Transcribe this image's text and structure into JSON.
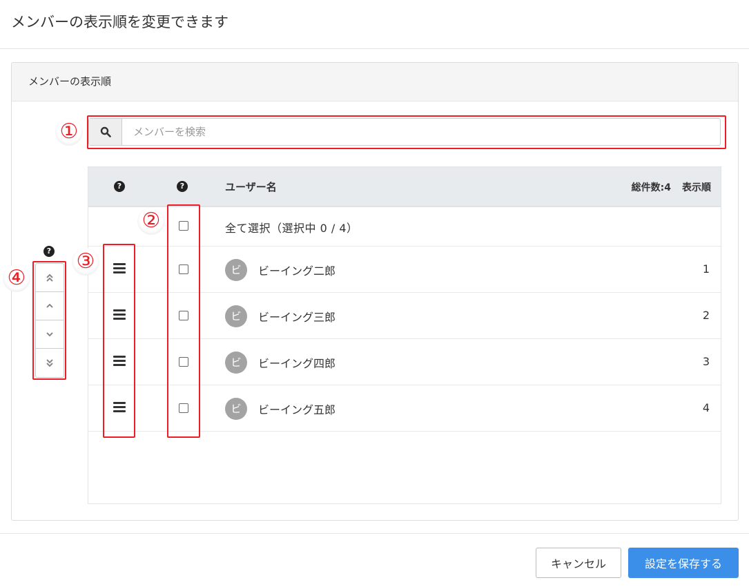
{
  "header": {
    "title": "メンバーの表示順を変更できます"
  },
  "panel": {
    "title": "メンバーの表示順"
  },
  "search": {
    "placeholder": "メンバーを検索",
    "icon": "search-icon"
  },
  "grid": {
    "columns": {
      "handle_help": "?",
      "select_help": "?",
      "user": "ユーザー名",
      "total": "総件数:4",
      "order": "表示順"
    },
    "select_all": "全て選択（選択中 0 / 4）",
    "members": [
      {
        "avatar": "ビ",
        "name": "ビーイング二郎",
        "order": "1"
      },
      {
        "avatar": "ビ",
        "name": "ビーイング三郎",
        "order": "2"
      },
      {
        "avatar": "ビ",
        "name": "ビーイング四郎",
        "order": "3"
      },
      {
        "avatar": "ビ",
        "name": "ビーイング五郎",
        "order": "4"
      }
    ]
  },
  "move_controls": {
    "help": "?",
    "buttons": [
      "move-to-top",
      "move-up",
      "move-down",
      "move-to-bottom"
    ]
  },
  "annotations": [
    "①",
    "②",
    "③",
    "④"
  ],
  "footer": {
    "cancel": "キャンセル",
    "save": "設定を保存する"
  },
  "colors": {
    "accent": "#3b8fe8",
    "annotation": "#ee1c25",
    "avatar": "#a3a3a3"
  }
}
